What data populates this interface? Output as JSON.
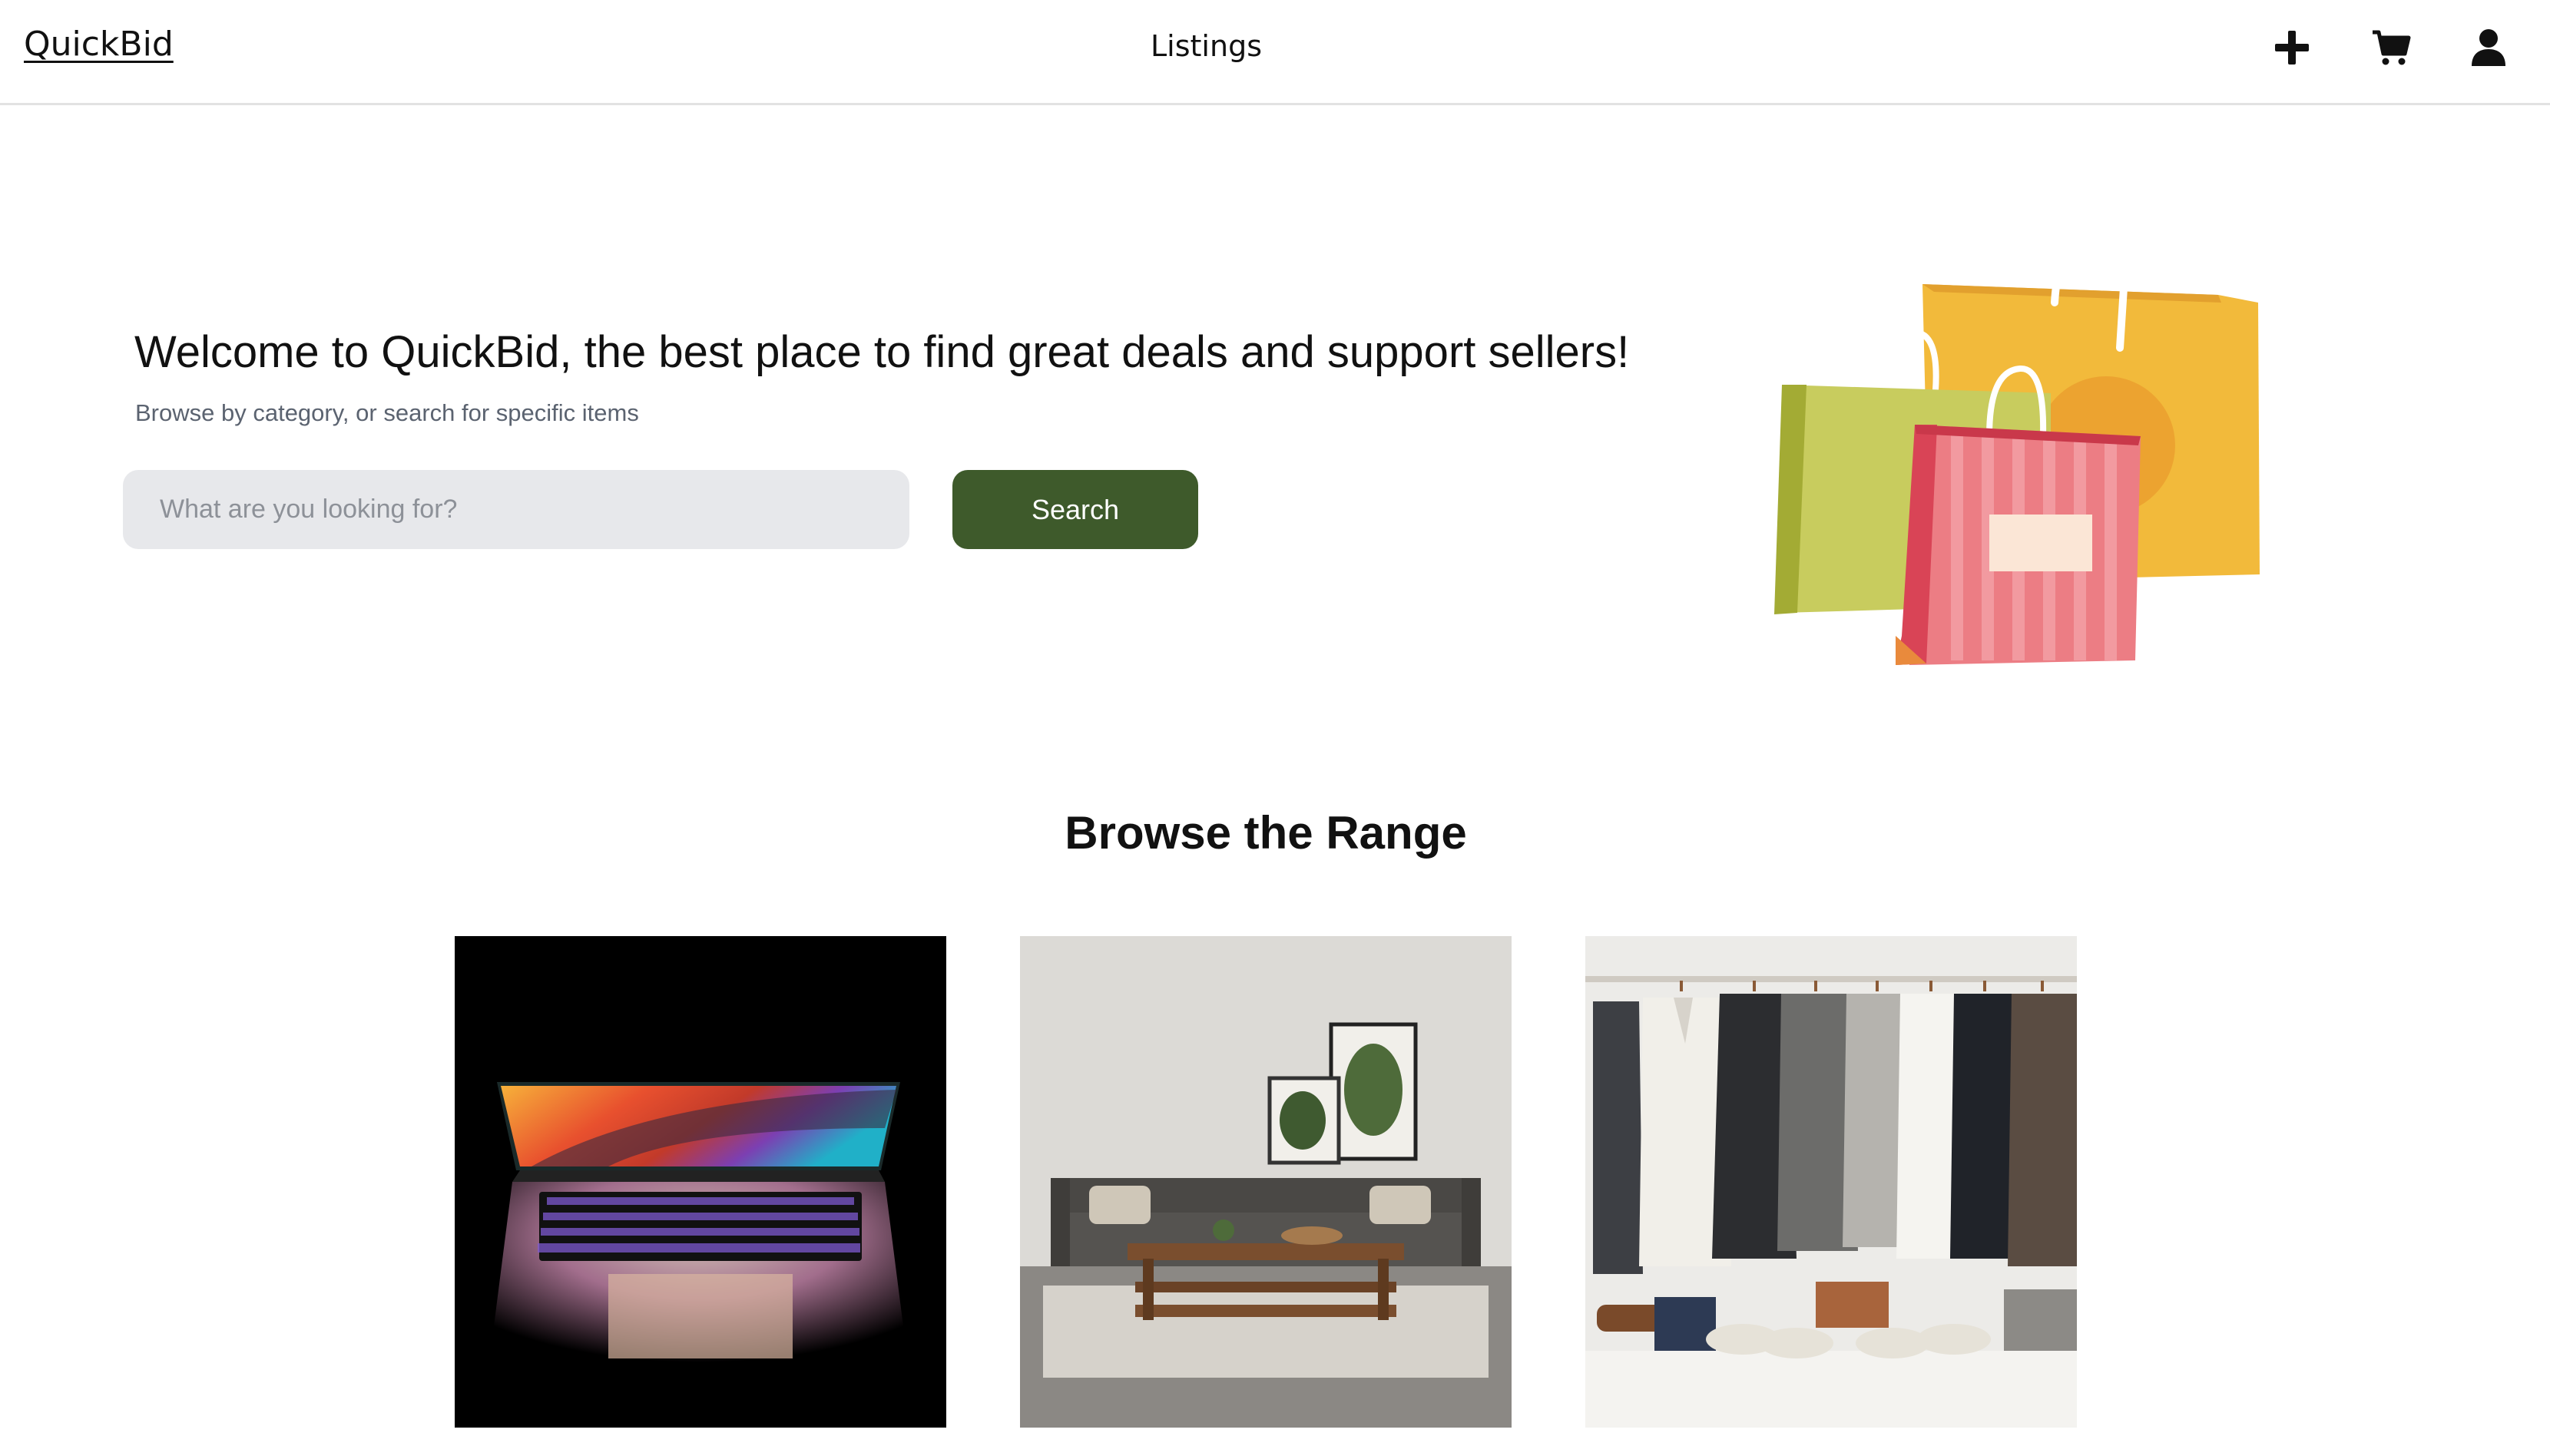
{
  "header": {
    "logo": "QuickBid",
    "nav_listings": "Listings",
    "icons": [
      "plus-icon",
      "cart-icon",
      "user-icon"
    ]
  },
  "hero": {
    "title": "Welcome to QuickBid, the best place to find great deals and support sellers!",
    "subtitle": "Browse by category, or search for specific items",
    "search": {
      "placeholder": "What are you looking for?",
      "value": "",
      "button_label": "Search"
    }
  },
  "browse": {
    "title": "Browse the Range",
    "categories": [
      "category-electronics-card",
      "category-furniture-card",
      "category-clothing-card"
    ]
  },
  "colors": {
    "accent": "#3e5a2b",
    "input_bg": "#e7e8eb",
    "subtitle": "#5b6370"
  }
}
